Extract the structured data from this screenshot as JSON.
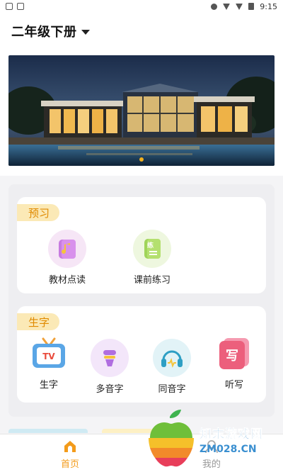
{
  "status_bar": {
    "time": "9:15"
  },
  "header": {
    "grade_selector": "二年级下册"
  },
  "banner": {
    "page_count": 1,
    "active_index": 0
  },
  "sections": [
    {
      "tag": "预习",
      "items": [
        {
          "label": "教材点读",
          "icon": "book-music-icon"
        },
        {
          "label": "课前练习",
          "icon": "practice-book-icon"
        }
      ]
    },
    {
      "tag": "生字",
      "items": [
        {
          "label": "生字",
          "icon": "tv-icon"
        },
        {
          "label": "多音字",
          "icon": "microphone-icon"
        },
        {
          "label": "同音字",
          "icon": "headphones-icon"
        },
        {
          "label": "听写",
          "icon": "write-card-icon"
        }
      ]
    }
  ],
  "tabbar": {
    "home": "首页",
    "mine": "我的"
  },
  "watermark": {
    "name": "知末游戏网",
    "url": "ZM028.CN"
  },
  "icons": {
    "practice_char": "练",
    "write_char": "写",
    "tv_text": "TV"
  },
  "colors": {
    "accent": "#f39b1a",
    "tag_bg": "#fbe9b6",
    "tag_text": "#e08a00"
  }
}
